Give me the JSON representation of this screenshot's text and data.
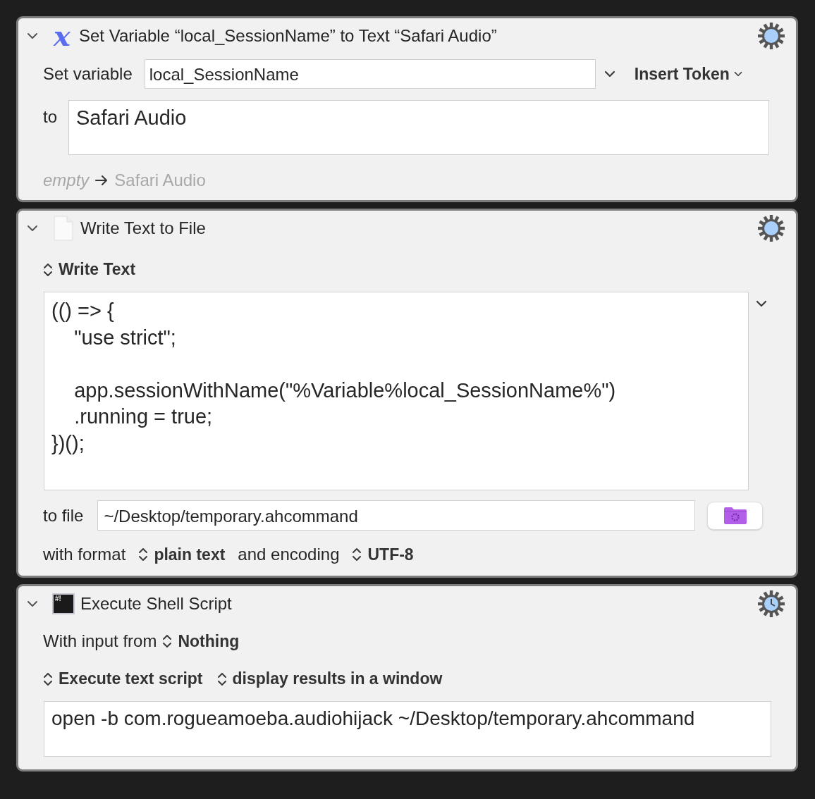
{
  "actions": [
    {
      "kind": "set_variable",
      "expanded": true,
      "timer": false,
      "icon_glyph": "x",
      "title": "Set Variable “local_SessionName” to Text “Safari Audio”",
      "variable_label": "Set variable",
      "variable_value": "local_SessionName",
      "insert_token": "Insert Token",
      "to_label": "to",
      "to_value": "Safari Audio",
      "preview_from": "empty",
      "preview_to": "Safari Audio"
    },
    {
      "kind": "write_file",
      "expanded": true,
      "timer": false,
      "title": "Write Text to File",
      "source": "Write Text",
      "text": "(() => {\n    \"use strict\";\n\n    app.sessionWithName(\"%Variable%local_SessionName%\")\n    .running = true;\n})();",
      "file_label": "to file",
      "file_value": "~/Desktop/temporary.ahcommand",
      "format_label": "with format",
      "format_value": "plain text",
      "encoding_label": "and encoding",
      "encoding_value": "UTF-8"
    },
    {
      "kind": "shell",
      "expanded": true,
      "timer": true,
      "icon_text": "#!",
      "title": "Execute Shell Script",
      "input_label": "With input from",
      "input_value": "Nothing",
      "mode": "Execute text script",
      "output": "display results in a window",
      "script": "open -b com.rogueamoeba.audiohijack ~/Desktop/temporary.ahcommand"
    }
  ]
}
